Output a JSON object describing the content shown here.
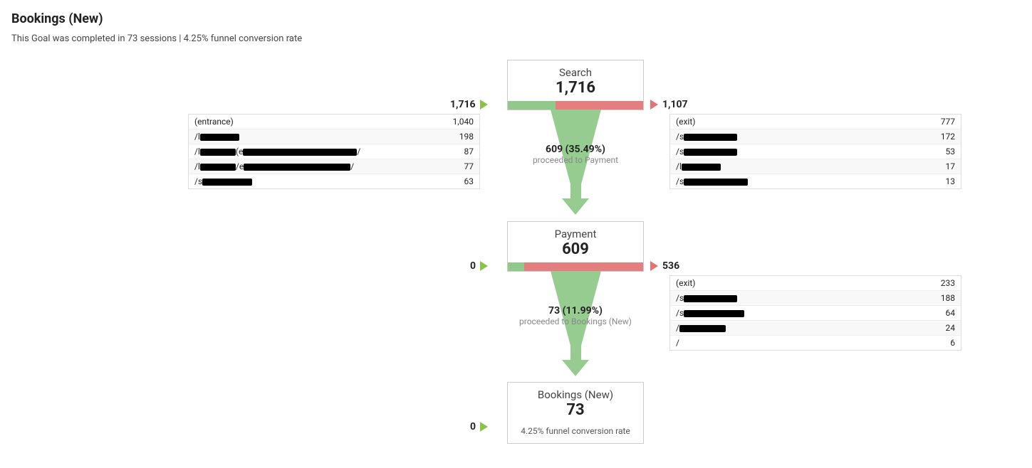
{
  "title": "Bookings (New)",
  "subtitle": "This Goal was completed in 73 sessions | 4.25% funnel conversion rate",
  "steps": [
    {
      "name": "Search",
      "value": "1,716",
      "in": "1,716",
      "out": "1,107",
      "green_pct": 35.49,
      "proceed_main": "609 (35.49%)",
      "proceed_sub": "proceeded to Payment",
      "left_rows": [
        {
          "label": "(entrance)",
          "redact_w": 0,
          "val": "1,040"
        },
        {
          "label": "/l",
          "redact_w": 55,
          "val": "198"
        },
        {
          "label": "/l",
          "redact_w": 220,
          "suffix": "/",
          "val": "87"
        },
        {
          "label": "/l",
          "redact_w": 210,
          "suffix": "/",
          "val": "77"
        },
        {
          "label": "/s",
          "redact_w": 70,
          "val": "63"
        }
      ],
      "right_rows": [
        {
          "label": "(exit)",
          "redact_w": 0,
          "val": "777"
        },
        {
          "label": "/s",
          "redact_w": 75,
          "val": "172"
        },
        {
          "label": "/s",
          "redact_w": 75,
          "val": "53"
        },
        {
          "label": "/l",
          "redact_w": 55,
          "val": "17"
        },
        {
          "label": "/s",
          "redact_w": 90,
          "val": "13"
        }
      ]
    },
    {
      "name": "Payment",
      "value": "609",
      "in": "0",
      "out": "536",
      "green_pct": 11.99,
      "proceed_main": "73 (11.99%)",
      "proceed_sub": "proceeded to Bookings (New)",
      "right_rows": [
        {
          "label": "(exit)",
          "redact_w": 0,
          "val": "233"
        },
        {
          "label": "/s",
          "redact_w": 75,
          "val": "188"
        },
        {
          "label": "/s",
          "redact_w": 85,
          "val": "64"
        },
        {
          "label": "/",
          "redact_w": 65,
          "val": "24"
        },
        {
          "label": "/",
          "redact_w": 0,
          "val": "6"
        }
      ]
    },
    {
      "name": "Bookings (New)",
      "value": "73",
      "in": "0",
      "subtext": "4.25% funnel conversion rate"
    }
  ]
}
